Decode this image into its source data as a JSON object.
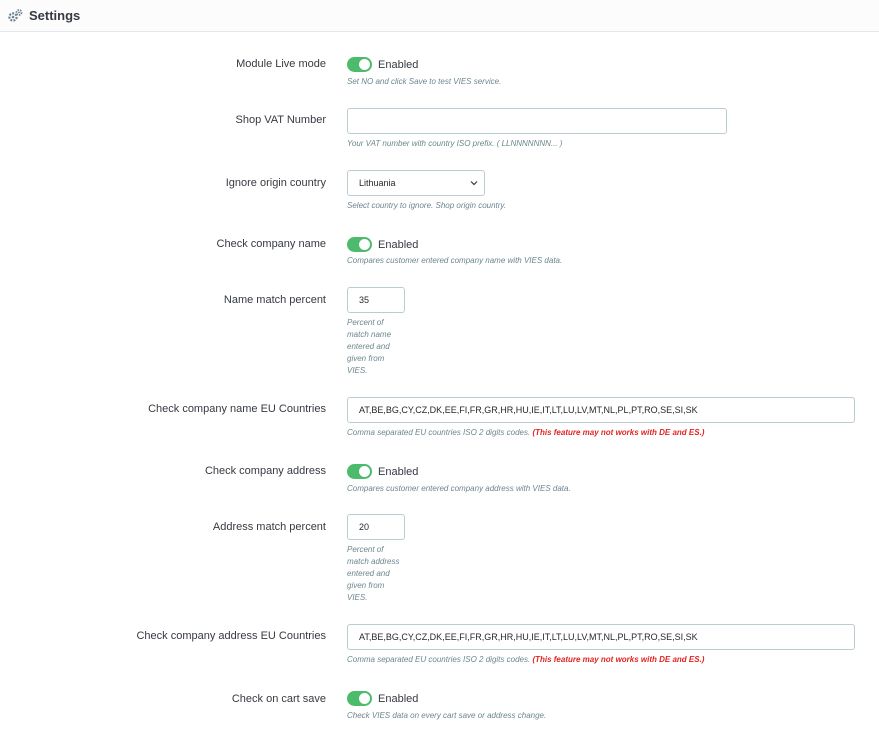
{
  "header": {
    "title": "Settings",
    "icon": "gears-icon"
  },
  "rows": {
    "live_mode": {
      "label": "Module Live mode",
      "state": "Enabled",
      "help": "Set NO and click Save to test VIES service."
    },
    "vat_number": {
      "label": "Shop VAT Number",
      "value": "",
      "help": "Your VAT number with country ISO prefix. ( LLNNNNNNN... )"
    },
    "ignore_country": {
      "label": "Ignore origin country",
      "value": "Lithuania",
      "help": "Select country to ignore. Shop origin country."
    },
    "check_name": {
      "label": "Check company name",
      "state": "Enabled",
      "help": "Compares customer entered company name with VIES data."
    },
    "name_percent": {
      "label": "Name match percent",
      "value": "35",
      "help_lines": [
        "Percent of",
        "match name",
        "entered and",
        "given from",
        "VIES."
      ]
    },
    "name_countries": {
      "label": "Check company name EU Countries",
      "value": "AT,BE,BG,CY,CZ,DK,EE,FI,FR,GR,HR,HU,IE,IT,LT,LU,LV,MT,NL,PL,PT,RO,SE,SI,SK",
      "help": "Comma separated EU countries ISO 2 digits codes.",
      "warning": "(This feature may not works with DE and ES.)"
    },
    "check_address": {
      "label": "Check company address",
      "state": "Enabled",
      "help": "Compares customer entered company address with VIES data."
    },
    "address_percent": {
      "label": "Address match percent",
      "value": "20",
      "help_lines": [
        "Percent of",
        "match address",
        "entered and",
        "given from",
        "VIES."
      ]
    },
    "address_countries": {
      "label": "Check company address EU Countries",
      "value": "AT,BE,BG,CY,CZ,DK,EE,FI,FR,GR,HR,HU,IE,IT,LT,LU,LV,MT,NL,PL,PT,RO,SE,SI,SK",
      "help": "Comma separated EU countries ISO 2 digits codes.",
      "warning": "(This feature may not works with DE and ES.)"
    },
    "cart_save": {
      "label": "Check on cart save",
      "state": "Enabled",
      "help": "Check VIES data on every cart save or address change."
    }
  },
  "colors": {
    "switch_on": "#4cbb6c",
    "warning": "#e02424",
    "help_text": "#6c868e",
    "border": "#bbcdd2"
  }
}
